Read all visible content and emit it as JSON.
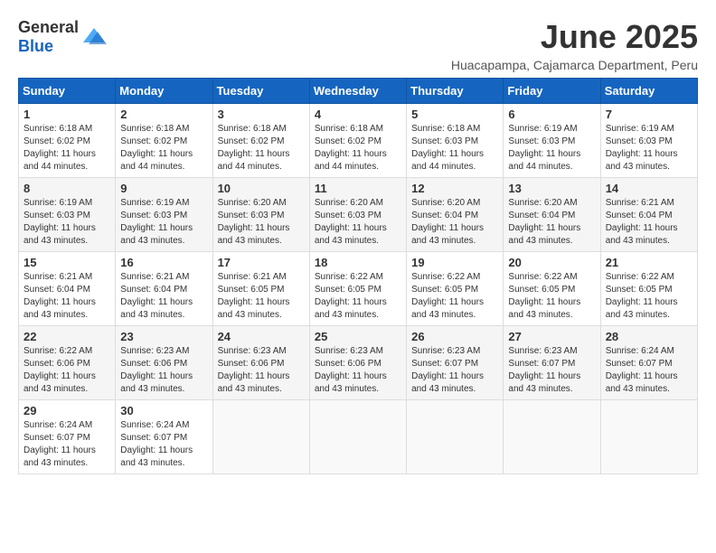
{
  "header": {
    "logo_general": "General",
    "logo_blue": "Blue",
    "month": "June 2025",
    "location": "Huacapampa, Cajamarca Department, Peru"
  },
  "weekdays": [
    "Sunday",
    "Monday",
    "Tuesday",
    "Wednesday",
    "Thursday",
    "Friday",
    "Saturday"
  ],
  "weeks": [
    [
      {
        "day": "1",
        "sunrise": "6:18 AM",
        "sunset": "6:02 PM",
        "daylight": "11 hours and 44 minutes."
      },
      {
        "day": "2",
        "sunrise": "6:18 AM",
        "sunset": "6:02 PM",
        "daylight": "11 hours and 44 minutes."
      },
      {
        "day": "3",
        "sunrise": "6:18 AM",
        "sunset": "6:02 PM",
        "daylight": "11 hours and 44 minutes."
      },
      {
        "day": "4",
        "sunrise": "6:18 AM",
        "sunset": "6:02 PM",
        "daylight": "11 hours and 44 minutes."
      },
      {
        "day": "5",
        "sunrise": "6:18 AM",
        "sunset": "6:03 PM",
        "daylight": "11 hours and 44 minutes."
      },
      {
        "day": "6",
        "sunrise": "6:19 AM",
        "sunset": "6:03 PM",
        "daylight": "11 hours and 44 minutes."
      },
      {
        "day": "7",
        "sunrise": "6:19 AM",
        "sunset": "6:03 PM",
        "daylight": "11 hours and 43 minutes."
      }
    ],
    [
      {
        "day": "8",
        "sunrise": "6:19 AM",
        "sunset": "6:03 PM",
        "daylight": "11 hours and 43 minutes."
      },
      {
        "day": "9",
        "sunrise": "6:19 AM",
        "sunset": "6:03 PM",
        "daylight": "11 hours and 43 minutes."
      },
      {
        "day": "10",
        "sunrise": "6:20 AM",
        "sunset": "6:03 PM",
        "daylight": "11 hours and 43 minutes."
      },
      {
        "day": "11",
        "sunrise": "6:20 AM",
        "sunset": "6:03 PM",
        "daylight": "11 hours and 43 minutes."
      },
      {
        "day": "12",
        "sunrise": "6:20 AM",
        "sunset": "6:04 PM",
        "daylight": "11 hours and 43 minutes."
      },
      {
        "day": "13",
        "sunrise": "6:20 AM",
        "sunset": "6:04 PM",
        "daylight": "11 hours and 43 minutes."
      },
      {
        "day": "14",
        "sunrise": "6:21 AM",
        "sunset": "6:04 PM",
        "daylight": "11 hours and 43 minutes."
      }
    ],
    [
      {
        "day": "15",
        "sunrise": "6:21 AM",
        "sunset": "6:04 PM",
        "daylight": "11 hours and 43 minutes."
      },
      {
        "day": "16",
        "sunrise": "6:21 AM",
        "sunset": "6:04 PM",
        "daylight": "11 hours and 43 minutes."
      },
      {
        "day": "17",
        "sunrise": "6:21 AM",
        "sunset": "6:05 PM",
        "daylight": "11 hours and 43 minutes."
      },
      {
        "day": "18",
        "sunrise": "6:22 AM",
        "sunset": "6:05 PM",
        "daylight": "11 hours and 43 minutes."
      },
      {
        "day": "19",
        "sunrise": "6:22 AM",
        "sunset": "6:05 PM",
        "daylight": "11 hours and 43 minutes."
      },
      {
        "day": "20",
        "sunrise": "6:22 AM",
        "sunset": "6:05 PM",
        "daylight": "11 hours and 43 minutes."
      },
      {
        "day": "21",
        "sunrise": "6:22 AM",
        "sunset": "6:05 PM",
        "daylight": "11 hours and 43 minutes."
      }
    ],
    [
      {
        "day": "22",
        "sunrise": "6:22 AM",
        "sunset": "6:06 PM",
        "daylight": "11 hours and 43 minutes."
      },
      {
        "day": "23",
        "sunrise": "6:23 AM",
        "sunset": "6:06 PM",
        "daylight": "11 hours and 43 minutes."
      },
      {
        "day": "24",
        "sunrise": "6:23 AM",
        "sunset": "6:06 PM",
        "daylight": "11 hours and 43 minutes."
      },
      {
        "day": "25",
        "sunrise": "6:23 AM",
        "sunset": "6:06 PM",
        "daylight": "11 hours and 43 minutes."
      },
      {
        "day": "26",
        "sunrise": "6:23 AM",
        "sunset": "6:07 PM",
        "daylight": "11 hours and 43 minutes."
      },
      {
        "day": "27",
        "sunrise": "6:23 AM",
        "sunset": "6:07 PM",
        "daylight": "11 hours and 43 minutes."
      },
      {
        "day": "28",
        "sunrise": "6:24 AM",
        "sunset": "6:07 PM",
        "daylight": "11 hours and 43 minutes."
      }
    ],
    [
      {
        "day": "29",
        "sunrise": "6:24 AM",
        "sunset": "6:07 PM",
        "daylight": "11 hours and 43 minutes."
      },
      {
        "day": "30",
        "sunrise": "6:24 AM",
        "sunset": "6:07 PM",
        "daylight": "11 hours and 43 minutes."
      },
      null,
      null,
      null,
      null,
      null
    ]
  ],
  "labels": {
    "sunrise": "Sunrise:",
    "sunset": "Sunset:",
    "daylight": "Daylight:"
  }
}
